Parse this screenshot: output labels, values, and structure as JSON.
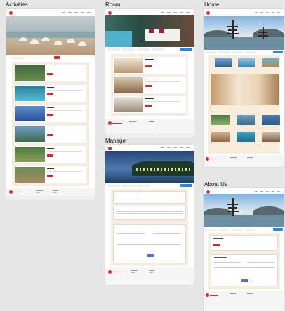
{
  "sections": {
    "activities": "Activities",
    "room": "Room",
    "home": "Home",
    "manage": "Manage",
    "about": "About Us"
  },
  "colors": {
    "brand_red": "#e02a25",
    "button_red": "#d92a2a",
    "search_blue": "#2d86d9",
    "submit_blue": "#5a6fd6",
    "cream_background": "#f8ecda",
    "canvas_gray": "#e6e6e6"
  }
}
